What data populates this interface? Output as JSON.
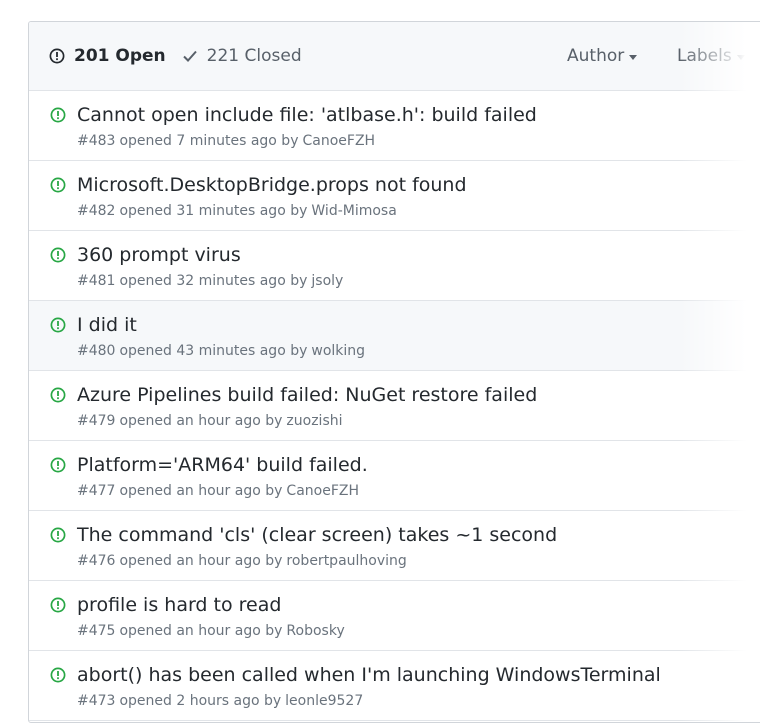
{
  "header": {
    "open_label": "201 Open",
    "closed_label": "221 Closed",
    "author_label": "Author",
    "labels_label": "Labels"
  },
  "colors": {
    "open_green": "#28a745",
    "header_bg": "#f6f8fa",
    "border": "#e1e4e8"
  },
  "issues": [
    {
      "title": "Cannot open include file: 'atlbase.h': build failed",
      "number": "#483",
      "time": "opened 7 minutes ago by",
      "author": "CanoeFZH"
    },
    {
      "title": "Microsoft.DesktopBridge.props not found",
      "number": "#482",
      "time": "opened 31 minutes ago by",
      "author": "Wid-Mimosa"
    },
    {
      "title": "360 prompt virus",
      "number": "#481",
      "time": "opened 32 minutes ago by",
      "author": "jsoly"
    },
    {
      "title": "I did it",
      "number": "#480",
      "time": "opened 43 minutes ago by",
      "author": "wolking"
    },
    {
      "title": "Azure Pipelines build failed: NuGet restore failed",
      "number": "#479",
      "time": "opened an hour ago by",
      "author": "zuozishi"
    },
    {
      "title": "Platform='ARM64' build failed.",
      "number": "#477",
      "time": "opened an hour ago by",
      "author": "CanoeFZH"
    },
    {
      "title": "The command 'cls' (clear screen) takes ~1 second",
      "number": "#476",
      "time": "opened an hour ago by",
      "author": "robertpaulhoving"
    },
    {
      "title": "profile is hard to read",
      "number": "#475",
      "time": "opened an hour ago by",
      "author": "Robosky"
    },
    {
      "title": "abort() has been called when I'm launching WindowsTerminal",
      "number": "#473",
      "time": "opened 2 hours ago by",
      "author": "leonle9527"
    }
  ]
}
